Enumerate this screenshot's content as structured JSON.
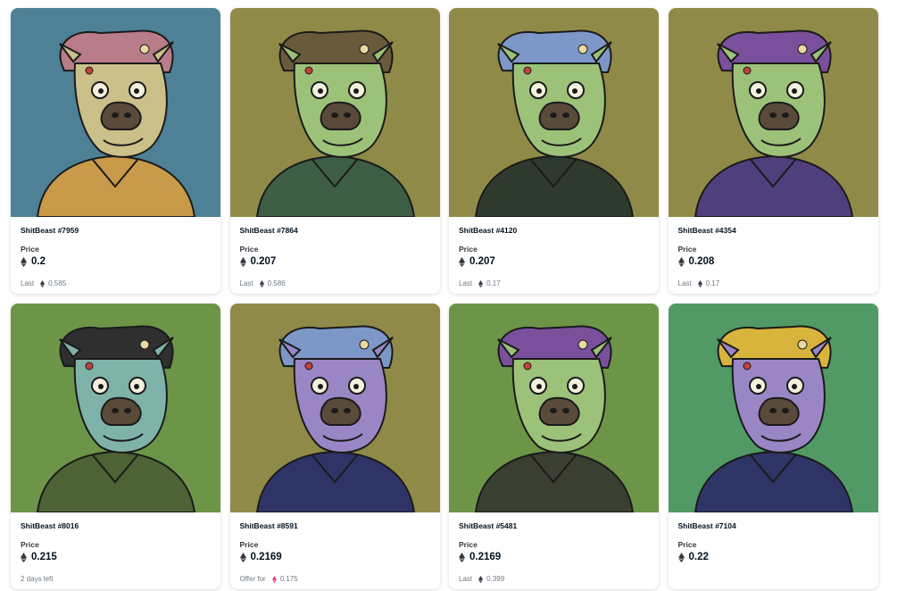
{
  "cards": [
    {
      "name": "ShitBeast #7959",
      "price_label": "Price",
      "price": "0.2",
      "footer_label": "Last",
      "footer_value": "0.585",
      "footer_icon": "eth-icon",
      "bg": "#4e8196",
      "theme": "blue"
    },
    {
      "name": "ShitBeast #7864",
      "price_label": "Price",
      "price": "0.207",
      "footer_label": "Last",
      "footer_value": "0.586",
      "footer_icon": "eth-icon",
      "bg": "#8f8a48",
      "theme": "olive"
    },
    {
      "name": "ShitBeast #4120",
      "price_label": "Price",
      "price": "0.207",
      "footer_label": "Last",
      "footer_value": "0.17",
      "footer_icon": "eth-icon",
      "bg": "#8f8a48",
      "theme": "olive"
    },
    {
      "name": "ShitBeast #4354",
      "price_label": "Price",
      "price": "0.208",
      "footer_label": "Last",
      "footer_value": "0.17",
      "footer_icon": "eth-icon",
      "bg": "#8f8a48",
      "theme": "olive"
    },
    {
      "name": "ShitBeast #8016",
      "price_label": "Price",
      "price": "0.215",
      "footer_label": "2 days left",
      "footer_value": "",
      "footer_icon": "",
      "bg": "#6c9548",
      "theme": "green"
    },
    {
      "name": "ShitBeast #8591",
      "price_label": "Price",
      "price": "0.2169",
      "footer_label": "Offer for",
      "footer_value": "0.175",
      "footer_icon": "weth-icon",
      "bg": "#8f8a48",
      "theme": "olive"
    },
    {
      "name": "ShitBeast #5481",
      "price_label": "Price",
      "price": "0.2169",
      "footer_label": "Last",
      "footer_value": "0.399",
      "footer_icon": "eth-icon",
      "bg": "#6c9548",
      "theme": "green"
    },
    {
      "name": "ShitBeast #7104",
      "price_label": "Price",
      "price": "0.22",
      "footer_label": "",
      "footer_value": "",
      "footer_icon": "",
      "bg": "#519965",
      "theme": "teal"
    }
  ],
  "colors": {
    "eth": "#353840",
    "weth": "#e0447a",
    "beast_skin_1": "#cbbf8a",
    "beast_skin_2": "#9cc27a",
    "beast_skin_3": "#7fb2a8",
    "beast_skin_4": "#9a86c4"
  }
}
